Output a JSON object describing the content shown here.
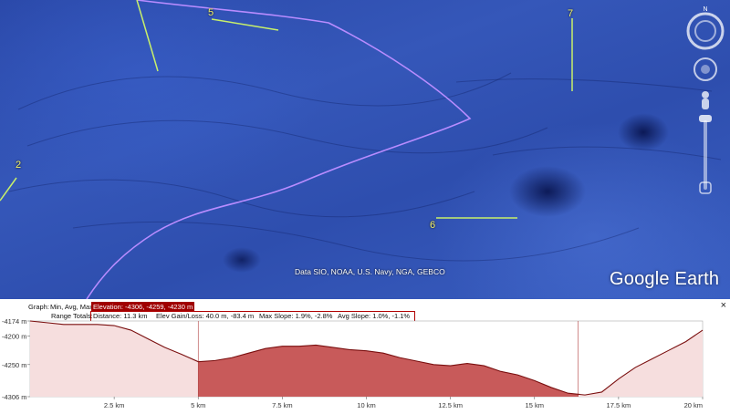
{
  "map": {
    "labels": {
      "route_2": "2",
      "route_5": "5",
      "route_6": "6",
      "route_7": "7"
    },
    "attribution": "Data SIO, NOAA, U.S. Navy, NGA, GEBCO",
    "brand": "Google Earth",
    "compass_letter": "N"
  },
  "profile": {
    "graph_label": "Graph:",
    "graph_mode": "Min, Avg, Max",
    "elevation": "Elevation: -4306, -4259, -4230 m",
    "range_label": "Range Totals:",
    "distance": "Distance: 11.3 km",
    "elev_gain_loss": "Elev Gain/Loss: 40.0 m, -83.4 m",
    "max_slope": "Max Slope: 1.9%, -2.8%",
    "avg_slope": "Avg Slope: 1.0%, -1.1%",
    "close": "×",
    "y_ticks": [
      "-4174 m",
      "-4200 m",
      "-4250 m",
      "-4306 m"
    ],
    "x_ticks": [
      "2.5 km",
      "5 km",
      "7.5 km",
      "10 km",
      "12.5 km",
      "15 km",
      "17.5 km",
      "20 km"
    ]
  },
  "chart_data": {
    "type": "area",
    "xlabel": "",
    "ylabel": "",
    "xlim": [
      0,
      20
    ],
    "ylim": [
      -4306,
      -4174
    ],
    "x": [
      0,
      0.5,
      1,
      2,
      2.5,
      3,
      3.5,
      4,
      4.5,
      5,
      5.5,
      6,
      6.5,
      7,
      7.5,
      8,
      8.5,
      9,
      9.5,
      10,
      10.5,
      11,
      11.5,
      12,
      12.5,
      13,
      13.5,
      14,
      14.5,
      15,
      15.5,
      16,
      16.5,
      17,
      17.5,
      18,
      18.5,
      19,
      19.5,
      20
    ],
    "y": [
      -4174,
      -4177,
      -4180,
      -4180,
      -4182,
      -4190,
      -4205,
      -4220,
      -4232,
      -4245,
      -4243,
      -4238,
      -4230,
      -4222,
      -4218,
      -4218,
      -4216,
      -4220,
      -4224,
      -4226,
      -4230,
      -4238,
      -4244,
      -4250,
      -4252,
      -4248,
      -4252,
      -4262,
      -4268,
      -4278,
      -4290,
      -4300,
      -4303,
      -4298,
      -4275,
      -4255,
      -4240,
      -4225,
      -4210,
      -4190
    ],
    "selected_range_km": [
      5,
      16.3
    ],
    "colors": {
      "line": "#7a0f0f",
      "fill": "#e08a8a",
      "selected_fill": "#c85a5a",
      "unselected_fill": "#f6dede"
    }
  }
}
